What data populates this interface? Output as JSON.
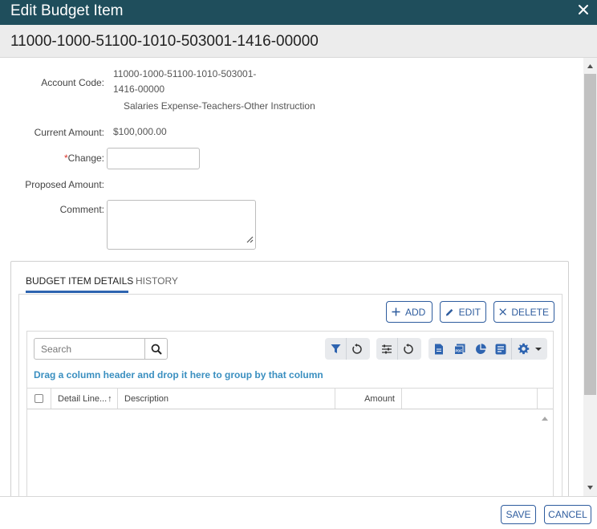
{
  "dialog": {
    "title": "Edit Budget Item",
    "subtitle": "11000-1000-51100-1010-503001-1416-00000"
  },
  "form": {
    "account_code_label": "Account Code:",
    "account_code_line1": "11000-1000-51100-1010-503001-",
    "account_code_line2": "1416-00000",
    "account_description": "Salaries Expense-Teachers-Other Instruction",
    "current_amount_label": "Current Amount:",
    "current_amount_value": "$100,000.00",
    "change_required_mark": "*",
    "change_label": "Change:",
    "change_value": "",
    "proposed_amount_label": "Proposed Amount:",
    "proposed_amount_value": "",
    "comment_label": "Comment:",
    "comment_value": ""
  },
  "tabs": [
    {
      "label": "BUDGET ITEM DETAILS",
      "active": true
    },
    {
      "label": "HISTORY",
      "active": false
    }
  ],
  "detail_actions": {
    "add": "ADD",
    "edit": "EDIT",
    "delete": "DELETE"
  },
  "grid": {
    "search_placeholder": "Search",
    "group_hint": "Drag a column header and drop it here to group by that column",
    "columns": [
      {
        "label": "Detail Line...",
        "sort": "↑"
      },
      {
        "label": "Description"
      },
      {
        "label": "Amount"
      }
    ],
    "rows": [],
    "toolbar_icons": [
      "filter-icon",
      "reset-filter-icon",
      "column-settings-icon",
      "reset-columns-icon",
      "export-document-icon",
      "export-pdf-icon",
      "chart-icon",
      "report-icon",
      "gear-icon"
    ]
  },
  "footer": {
    "save": "SAVE",
    "cancel": "CANCEL"
  },
  "colors": {
    "title_bar": "#1f4e5c",
    "accent": "#2e5c9e",
    "hint": "#3a8fc0",
    "required": "#d9342b"
  }
}
